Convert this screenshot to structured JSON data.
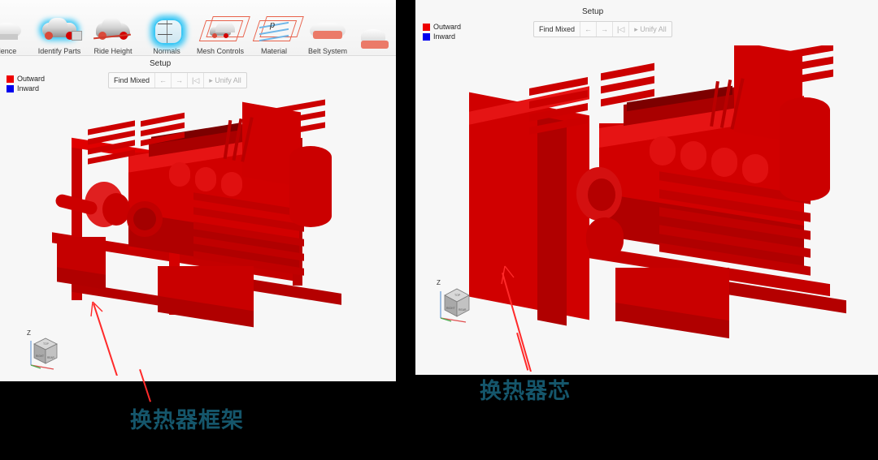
{
  "meta": {
    "background_color": "#000000",
    "panel_background": "#f7f7f7",
    "accent_red": "#d40000",
    "annotation_color": "#15566b",
    "leader_color": "#ff2a2a"
  },
  "left_panel": {
    "ribbon": {
      "items": [
        {
          "label": "ulence",
          "icon": "turbulence-icon",
          "truncated": true,
          "highlighted": false
        },
        {
          "label": "Identify Parts",
          "icon": "identify-parts-icon",
          "highlighted": true
        },
        {
          "label": "Ride Height",
          "icon": "ride-height-icon",
          "highlighted": false
        },
        {
          "label": "Normals",
          "icon": "normals-icon",
          "highlighted": true
        },
        {
          "label": "Mesh Controls",
          "icon": "mesh-controls-icon",
          "highlighted": false
        },
        {
          "label": "Material",
          "icon": "material-icon",
          "highlighted": false
        },
        {
          "label": "Belt System",
          "icon": "belt-system-icon",
          "highlighted": false
        },
        {
          "label": "",
          "icon": "partial-icon",
          "truncated": true,
          "highlighted": false
        }
      ]
    },
    "setup": {
      "title": "Setup",
      "legend": [
        {
          "label": "Outward",
          "color": "#ee0000"
        },
        {
          "label": "Inward",
          "color": "#0000ee"
        }
      ],
      "buttons": [
        {
          "label": "Find Mixed",
          "name": "find-mixed-button",
          "disabled": false
        },
        {
          "label": "←",
          "name": "previous-button",
          "disabled": true
        },
        {
          "label": "→",
          "name": "next-button",
          "disabled": true
        },
        {
          "label": "|◁",
          "name": "first-button",
          "disabled": true
        },
        {
          "label": "▸ Unify All",
          "name": "unify-all-button",
          "disabled": true
        }
      ]
    },
    "viewport": {
      "axis_label": "Z",
      "view_cube_faces": [
        "TOP",
        "RIGHT",
        "REAR"
      ],
      "model_name": "heat-exchanger-assembly-with-frame"
    },
    "annotation": {
      "text": "换热器框架",
      "color": "#15566b"
    }
  },
  "right_panel": {
    "setup": {
      "title": "Setup",
      "legend": [
        {
          "label": "Outward",
          "color": "#ee0000"
        },
        {
          "label": "Inward",
          "color": "#0000ee"
        }
      ],
      "buttons": [
        {
          "label": "Find Mixed",
          "name": "find-mixed-button",
          "disabled": false
        },
        {
          "label": "←",
          "name": "previous-button",
          "disabled": true
        },
        {
          "label": "→",
          "name": "next-button",
          "disabled": true
        },
        {
          "label": "|◁",
          "name": "first-button",
          "disabled": true
        },
        {
          "label": "▸ Unify All",
          "name": "unify-all-button",
          "disabled": true
        }
      ]
    },
    "viewport": {
      "axis_label": "Z",
      "view_cube_faces": [
        "TOP",
        "RIGHT",
        "REAR"
      ],
      "model_name": "heat-exchanger-assembly-with-core-plate"
    },
    "annotation": {
      "text": "换热器芯",
      "color": "#15566b"
    }
  }
}
